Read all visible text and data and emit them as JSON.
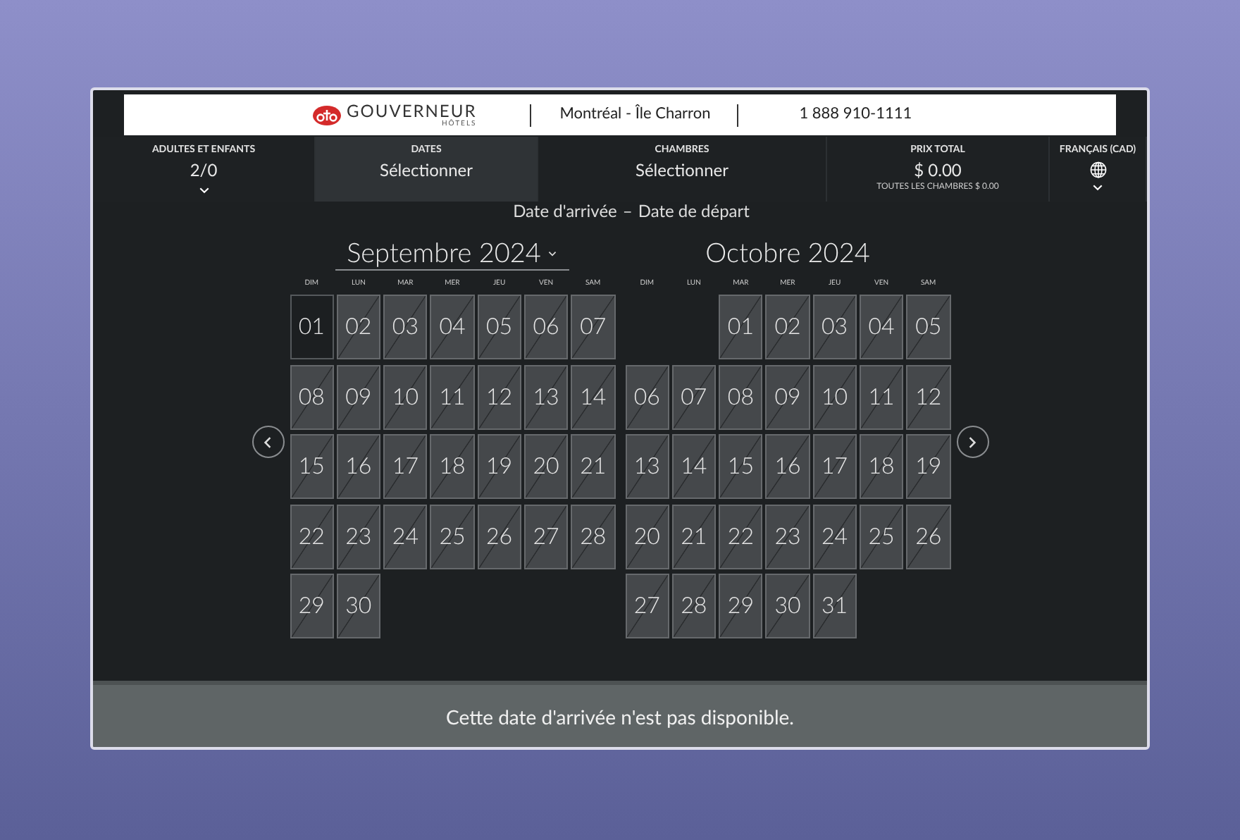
{
  "header": {
    "brand": "GOUVERNEUR",
    "brand_sub": "HÔTELS",
    "location": "Montréal - Île Charron",
    "phone": "1 888 910-1111"
  },
  "nav": [
    {
      "label": "ADULTES ET ENFANTS",
      "value": "2/0",
      "kind": "dropdown",
      "selected": false
    },
    {
      "label": "DATES",
      "value": "Sélectionner",
      "kind": "plain",
      "selected": true
    },
    {
      "label": "CHAMBRES",
      "value": "Sélectionner",
      "kind": "plain",
      "selected": false
    },
    {
      "label": "PRIX TOTAL",
      "value": "$ 0.00",
      "note": "TOUTES LES CHAMBRES $ 0.00",
      "kind": "plain",
      "selected": false
    },
    {
      "label": "FRANÇAIS (CAD)",
      "kind": "language",
      "selected": false
    }
  ],
  "calendar": {
    "range_start": "Date d'arrivée",
    "range_sep": "–",
    "range_end": "Date de départ",
    "months": [
      {
        "title": "Septembre 2024",
        "has_dropdown": true,
        "weekdays": [
          "DIM",
          "LUN",
          "MAR",
          "MER",
          "JEU",
          "VEN",
          "SAM"
        ],
        "days": [
          {
            "kind": "day",
            "text": "01",
            "selected": true,
            "unavailable": false
          },
          {
            "kind": "day",
            "text": "02",
            "selected": false,
            "unavailable": true
          },
          {
            "kind": "day",
            "text": "03",
            "selected": false,
            "unavailable": true
          },
          {
            "kind": "day",
            "text": "04",
            "selected": false,
            "unavailable": true
          },
          {
            "kind": "day",
            "text": "05",
            "selected": false,
            "unavailable": true
          },
          {
            "kind": "day",
            "text": "06",
            "selected": false,
            "unavailable": true
          },
          {
            "kind": "day",
            "text": "07",
            "selected": false,
            "unavailable": true
          },
          {
            "kind": "day",
            "text": "08",
            "selected": false,
            "unavailable": true
          },
          {
            "kind": "day",
            "text": "09",
            "selected": false,
            "unavailable": true
          },
          {
            "kind": "day",
            "text": "10",
            "selected": false,
            "unavailable": true
          },
          {
            "kind": "day",
            "text": "11",
            "selected": false,
            "unavailable": true
          },
          {
            "kind": "day",
            "text": "12",
            "selected": false,
            "unavailable": true
          },
          {
            "kind": "day",
            "text": "13",
            "selected": false,
            "unavailable": true
          },
          {
            "kind": "day",
            "text": "14",
            "selected": false,
            "unavailable": true
          },
          {
            "kind": "day",
            "text": "15",
            "selected": false,
            "unavailable": true
          },
          {
            "kind": "day",
            "text": "16",
            "selected": false,
            "unavailable": true
          },
          {
            "kind": "day",
            "text": "17",
            "selected": false,
            "unavailable": true
          },
          {
            "kind": "day",
            "text": "18",
            "selected": false,
            "unavailable": true
          },
          {
            "kind": "day",
            "text": "19",
            "selected": false,
            "unavailable": true
          },
          {
            "kind": "day",
            "text": "20",
            "selected": false,
            "unavailable": true
          },
          {
            "kind": "day",
            "text": "21",
            "selected": false,
            "unavailable": true
          },
          {
            "kind": "day",
            "text": "22",
            "selected": false,
            "unavailable": true
          },
          {
            "kind": "day",
            "text": "23",
            "selected": false,
            "unavailable": true
          },
          {
            "kind": "day",
            "text": "24",
            "selected": false,
            "unavailable": true
          },
          {
            "kind": "day",
            "text": "25",
            "selected": false,
            "unavailable": true
          },
          {
            "kind": "day",
            "text": "26",
            "selected": false,
            "unavailable": true
          },
          {
            "kind": "day",
            "text": "27",
            "selected": false,
            "unavailable": true
          },
          {
            "kind": "day",
            "text": "28",
            "selected": false,
            "unavailable": true
          },
          {
            "kind": "day",
            "text": "29",
            "selected": false,
            "unavailable": true
          },
          {
            "kind": "day",
            "text": "30",
            "selected": false,
            "unavailable": true
          }
        ]
      },
      {
        "title": "Octobre 2024",
        "has_dropdown": false,
        "weekdays": [
          "DIM",
          "LUN",
          "MAR",
          "MER",
          "JEU",
          "VEN",
          "SAM"
        ],
        "days": [
          {
            "kind": "blank"
          },
          {
            "kind": "blank"
          },
          {
            "kind": "day",
            "text": "01",
            "selected": false,
            "unavailable": true
          },
          {
            "kind": "day",
            "text": "02",
            "selected": false,
            "unavailable": true
          },
          {
            "kind": "day",
            "text": "03",
            "selected": false,
            "unavailable": true
          },
          {
            "kind": "day",
            "text": "04",
            "selected": false,
            "unavailable": true
          },
          {
            "kind": "day",
            "text": "05",
            "selected": false,
            "unavailable": true
          },
          {
            "kind": "day",
            "text": "06",
            "selected": false,
            "unavailable": true
          },
          {
            "kind": "day",
            "text": "07",
            "selected": false,
            "unavailable": true
          },
          {
            "kind": "day",
            "text": "08",
            "selected": false,
            "unavailable": true
          },
          {
            "kind": "day",
            "text": "09",
            "selected": false,
            "unavailable": true
          },
          {
            "kind": "day",
            "text": "10",
            "selected": false,
            "unavailable": true
          },
          {
            "kind": "day",
            "text": "11",
            "selected": false,
            "unavailable": true
          },
          {
            "kind": "day",
            "text": "12",
            "selected": false,
            "unavailable": true
          },
          {
            "kind": "day",
            "text": "13",
            "selected": false,
            "unavailable": true
          },
          {
            "kind": "day",
            "text": "14",
            "selected": false,
            "unavailable": true
          },
          {
            "kind": "day",
            "text": "15",
            "selected": false,
            "unavailable": true
          },
          {
            "kind": "day",
            "text": "16",
            "selected": false,
            "unavailable": true
          },
          {
            "kind": "day",
            "text": "17",
            "selected": false,
            "unavailable": true
          },
          {
            "kind": "day",
            "text": "18",
            "selected": false,
            "unavailable": true
          },
          {
            "kind": "day",
            "text": "19",
            "selected": false,
            "unavailable": true
          },
          {
            "kind": "day",
            "text": "20",
            "selected": false,
            "unavailable": true
          },
          {
            "kind": "day",
            "text": "21",
            "selected": false,
            "unavailable": true
          },
          {
            "kind": "day",
            "text": "22",
            "selected": false,
            "unavailable": true
          },
          {
            "kind": "day",
            "text": "23",
            "selected": false,
            "unavailable": true
          },
          {
            "kind": "day",
            "text": "24",
            "selected": false,
            "unavailable": true
          },
          {
            "kind": "day",
            "text": "25",
            "selected": false,
            "unavailable": true
          },
          {
            "kind": "day",
            "text": "26",
            "selected": false,
            "unavailable": true
          },
          {
            "kind": "day",
            "text": "27",
            "selected": false,
            "unavailable": true
          },
          {
            "kind": "day",
            "text": "28",
            "selected": false,
            "unavailable": true
          },
          {
            "kind": "day",
            "text": "29",
            "selected": false,
            "unavailable": true
          },
          {
            "kind": "day",
            "text": "30",
            "selected": false,
            "unavailable": true
          },
          {
            "kind": "day",
            "text": "31",
            "selected": false,
            "unavailable": true
          }
        ]
      }
    ]
  },
  "message": "Cette date d'arrivée n'est pas disponible."
}
